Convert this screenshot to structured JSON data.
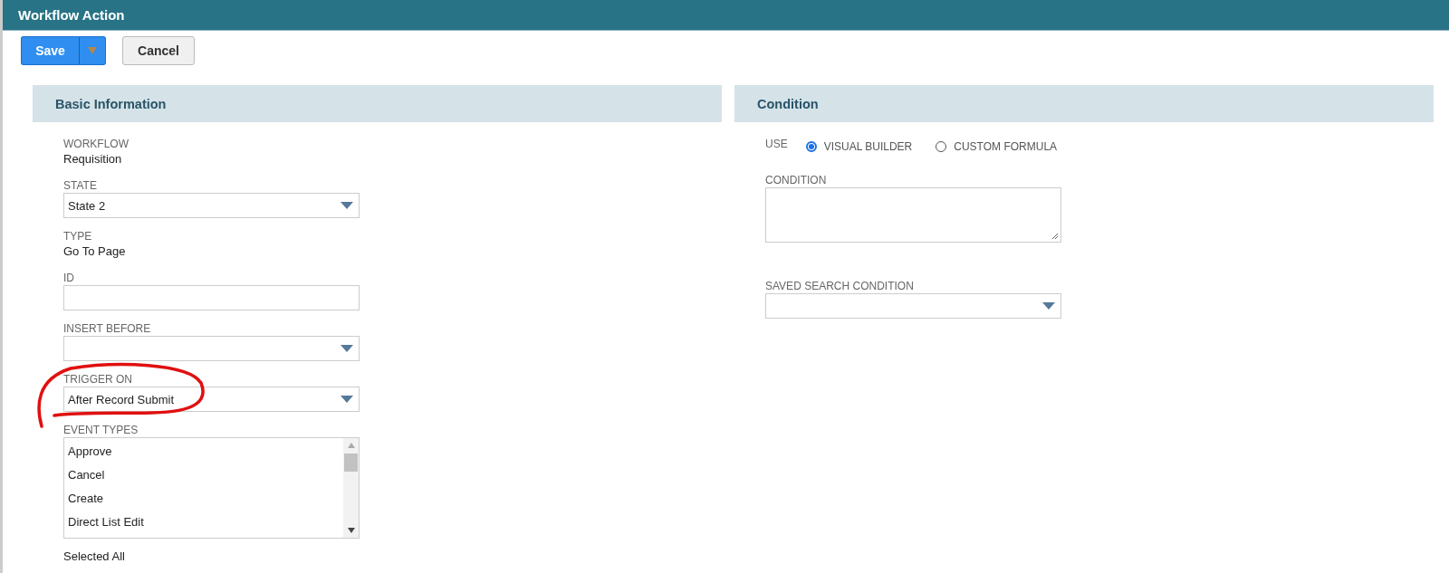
{
  "window": {
    "title": "Workflow Action"
  },
  "buttons": {
    "save": "Save",
    "cancel": "Cancel"
  },
  "basic_information": {
    "title": "Basic Information",
    "fields": [
      {
        "kind": "static",
        "label": "WORKFLOW",
        "value": "Requisition"
      },
      {
        "kind": "select",
        "label": "STATE",
        "value": "State 2"
      },
      {
        "kind": "static",
        "label": "TYPE",
        "value": "Go To Page"
      },
      {
        "kind": "input",
        "label": "ID"
      },
      {
        "kind": "select",
        "label": "INSERT BEFORE"
      },
      {
        "kind": "select",
        "label": "TRIGGER ON",
        "value": "After Record Submit"
      },
      {
        "kind": "list",
        "label": "EVENT TYPES",
        "items": [
          "Approve",
          "Cancel",
          "Create",
          "Direct List Edit"
        ]
      }
    ],
    "footer": "Selected All"
  },
  "condition": {
    "title": "Condition",
    "use_label": "USE",
    "options": [
      {
        "label": "VISUAL BUILDER",
        "selected": true
      },
      {
        "label": "CUSTOM FORMULA",
        "selected": false
      }
    ],
    "fields": [
      {
        "kind": "textarea",
        "label": "CONDITION"
      },
      {
        "kind": "select",
        "label": "SAVED SEARCH CONDITION"
      }
    ]
  }
}
